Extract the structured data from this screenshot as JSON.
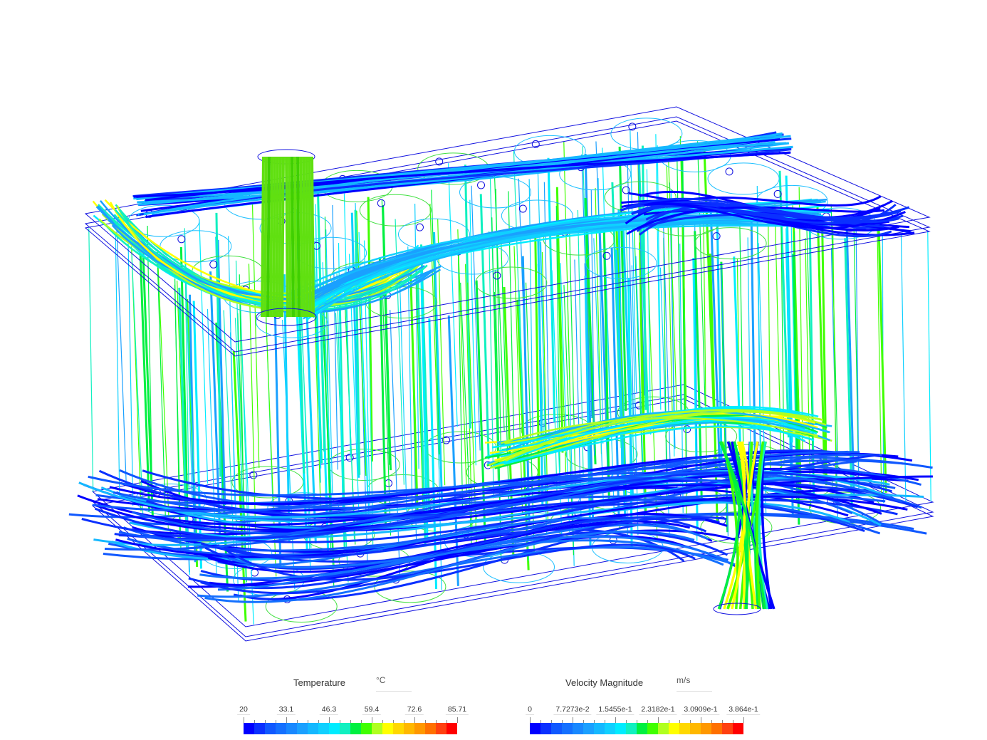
{
  "colormap": [
    "#0000ff",
    "#0a30ff",
    "#1058ff",
    "#1470ff",
    "#1888ff",
    "#1aa0ff",
    "#14b8ff",
    "#10d0ff",
    "#00ecff",
    "#10f0c0",
    "#00f040",
    "#40ff00",
    "#b0ff20",
    "#ffff00",
    "#ffd800",
    "#ffb800",
    "#ff9800",
    "#ff7000",
    "#ff4010",
    "#ff0000"
  ],
  "legends": [
    {
      "title": "Temperature",
      "unit": "°C",
      "ticks": [
        "20",
        "33.1",
        "46.3",
        "59.4",
        "72.6",
        "85.71"
      ]
    },
    {
      "title": "Velocity Magnitude",
      "unit": "m/s",
      "ticks": [
        "0",
        "7.7273e-2",
        "1.5455e-1",
        "2.3182e-1",
        "3.0909e-1",
        "3.864e-1"
      ]
    }
  ]
}
